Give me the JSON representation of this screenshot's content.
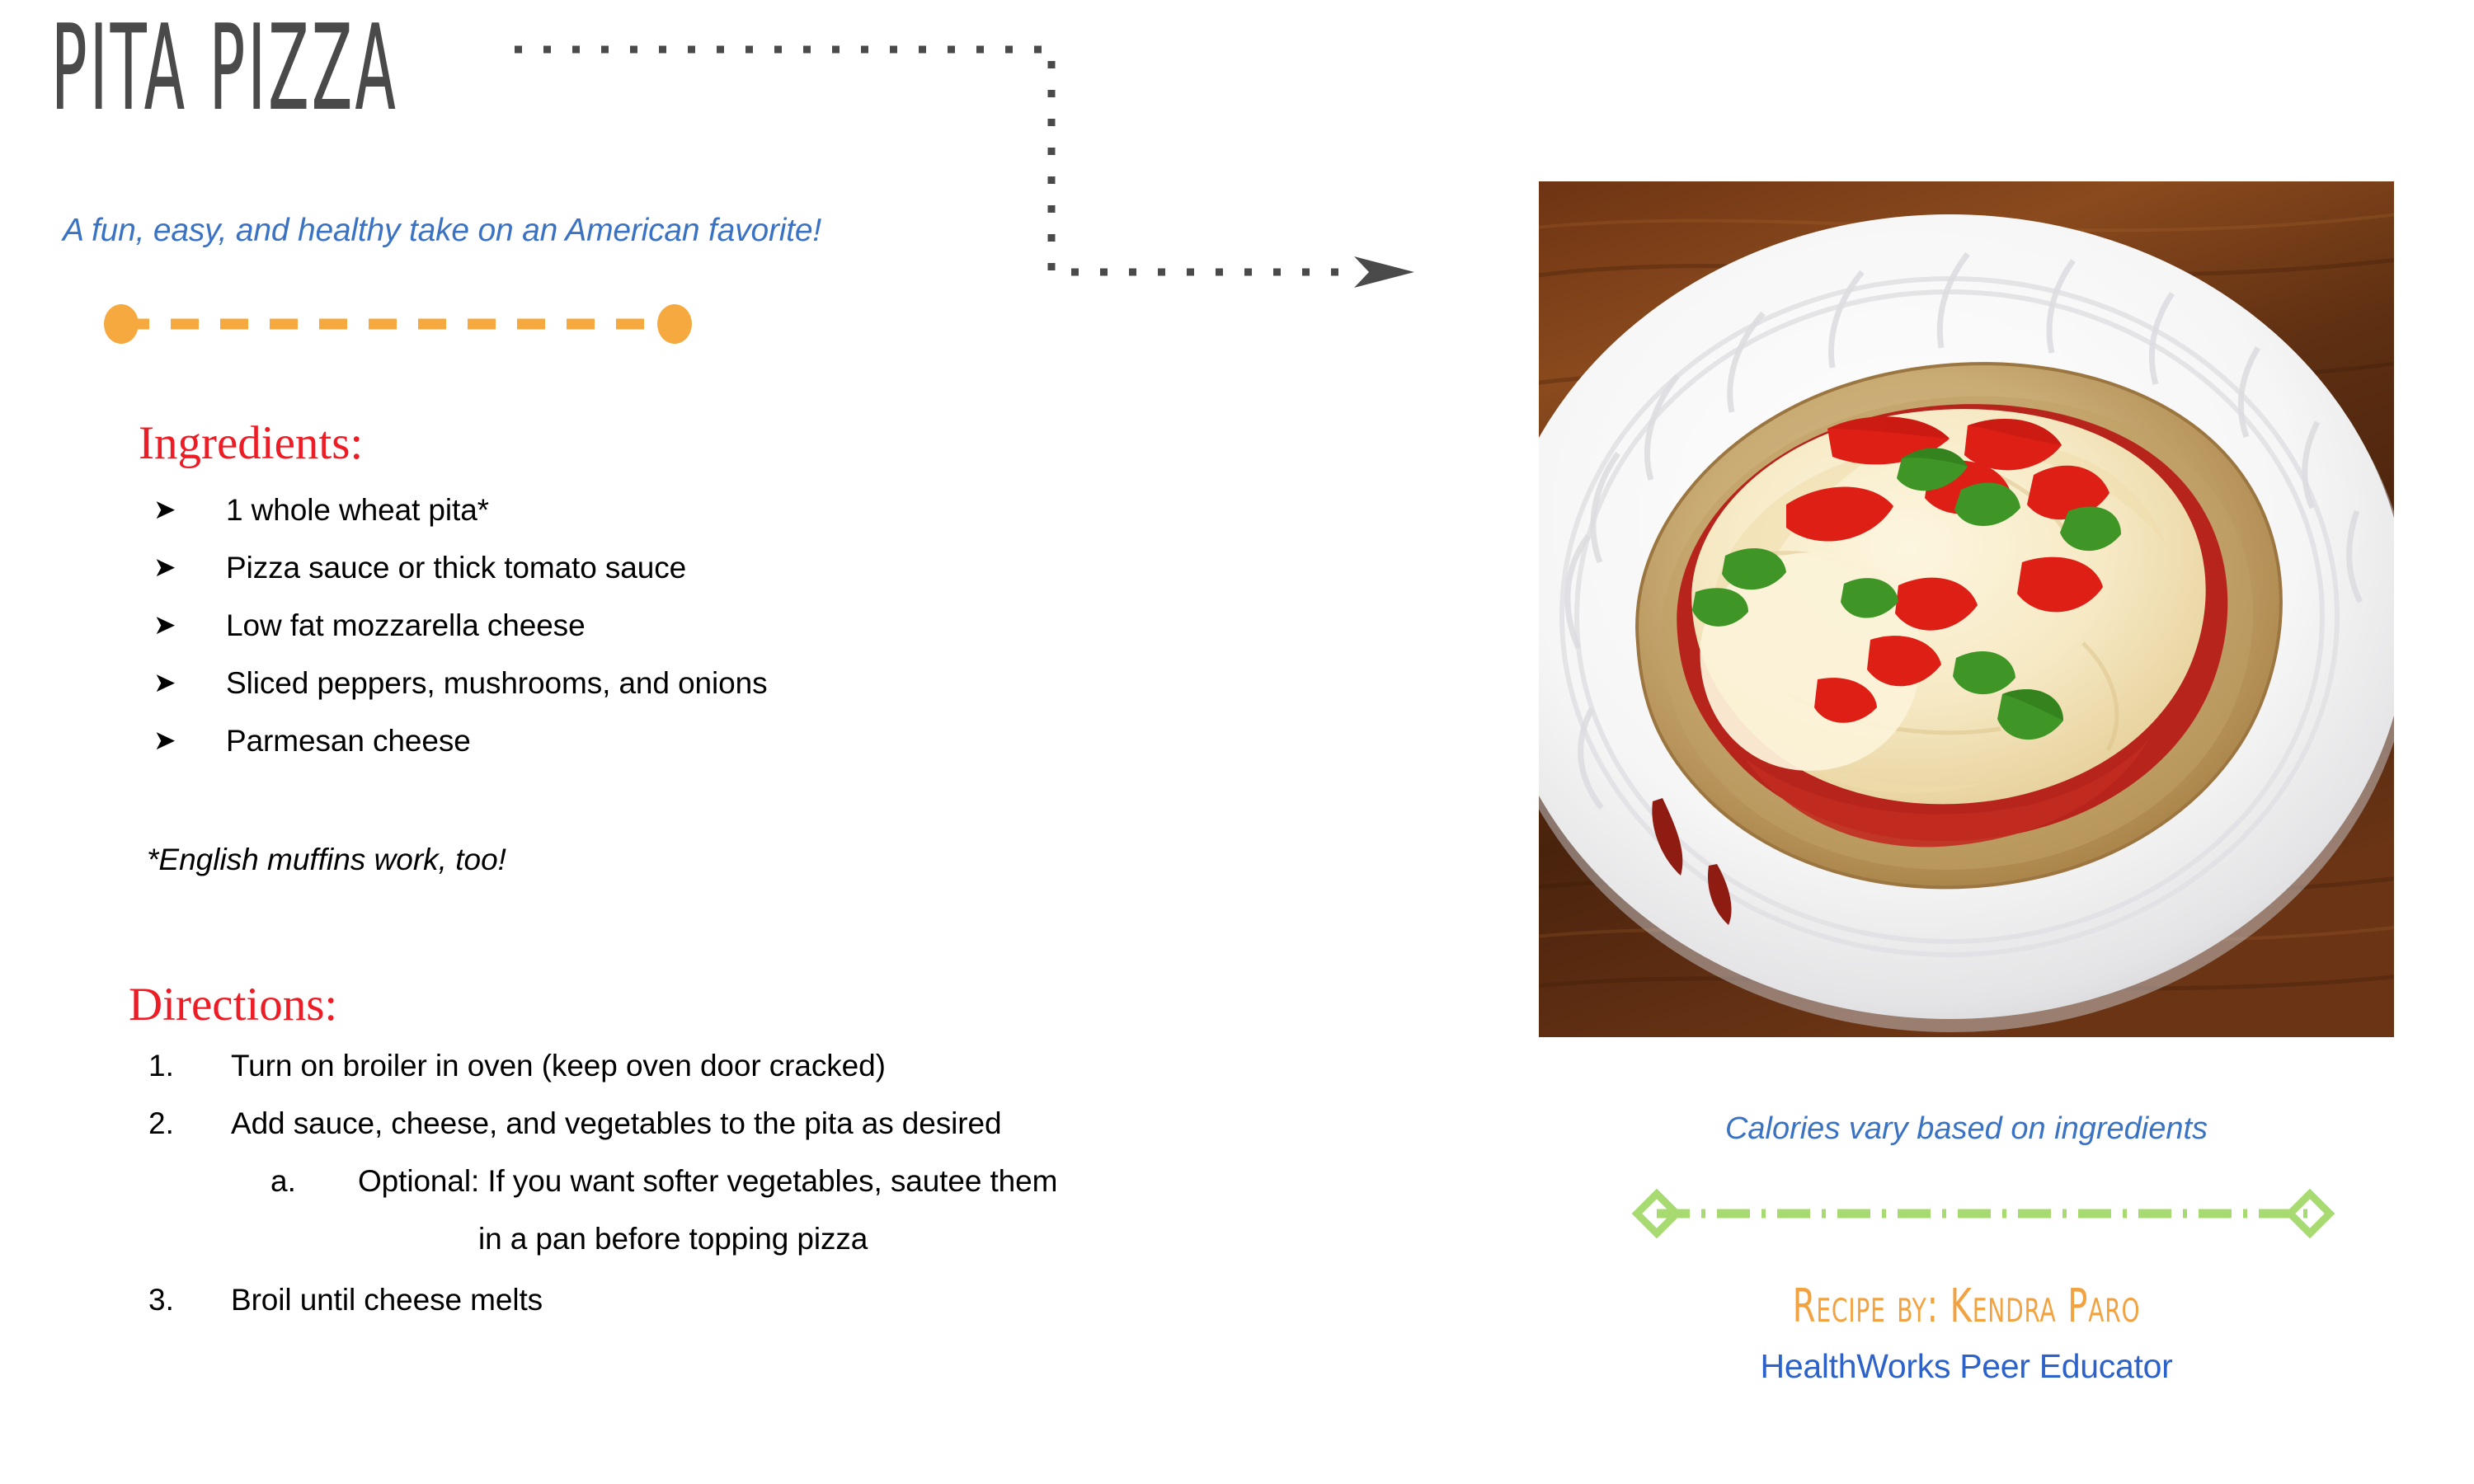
{
  "title": "Pita Pizza",
  "subtitle": "A fun, easy, and healthy take on an American favorite!",
  "colors": {
    "title_gray": "#4a4a4a",
    "title_accent_green": "#22b222",
    "subtitle_blue": "#3a72c4",
    "heading_red": "#ee1c25",
    "divider_orange": "#f5a93f",
    "divider_green": "#a8da72",
    "author_orange": "#f2a341",
    "org_blue": "#2c62c9",
    "connector_gray": "#4a4a4a",
    "body_black": "#000000"
  },
  "ingredients": {
    "heading": "Ingredients:",
    "bullet_icon": "arrow-bullet-icon",
    "items": [
      "1 whole wheat pita*",
      "Pizza sauce or thick tomato sauce",
      "Low fat mozzarella cheese",
      "Sliced peppers, mushrooms, and onions",
      "Parmesan cheese"
    ],
    "note": "*English muffins work, too!"
  },
  "directions": {
    "heading": "Directions:",
    "items": [
      {
        "marker": "1.",
        "text": "Turn on broiler in oven (keep oven door cracked)",
        "level": 0
      },
      {
        "marker": "2.",
        "text": "Add sauce, cheese, and vegetables to the pita as desired",
        "level": 0
      },
      {
        "marker": "a.",
        "text": "Optional: If you want softer vegetables, sautee them",
        "level": 1
      },
      {
        "marker": "",
        "text": "in a pan before topping pizza",
        "level": 2
      },
      {
        "marker": "3.",
        "text": "Broil until cheese melts",
        "level": 0
      }
    ]
  },
  "photo": {
    "alt_name": "pita-pizza-photo",
    "description": "Pita pizza with melted mozzarella, red peppers and spinach on a white paper plate on a wooden table",
    "caption": "Calories vary based on ingredients"
  },
  "credits": {
    "author": "Recipe by: Kendra Paro",
    "organization": "HealthWorks Peer Educator"
  },
  "dividers": {
    "orange": {
      "name": "orange-dashed-divider",
      "endpoint_shape": "circle"
    },
    "green": {
      "name": "green-dashdot-divider",
      "endpoint_shape": "diamond"
    },
    "connector": {
      "name": "dotted-connector-arrow",
      "endpoint_shape": "arrowhead"
    }
  }
}
